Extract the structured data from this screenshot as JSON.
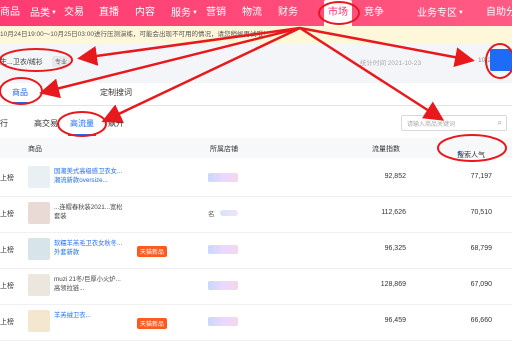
{
  "topnav": {
    "items": [
      {
        "label": "商品",
        "caret": false
      },
      {
        "label": "品类",
        "caret": true
      },
      {
        "label": "交易",
        "caret": false
      },
      {
        "label": "直播",
        "caret": false
      },
      {
        "label": "内容",
        "caret": false
      },
      {
        "label": "服务",
        "caret": true
      },
      {
        "label": "营销",
        "caret": false
      },
      {
        "label": "物流",
        "caret": false
      },
      {
        "label": "财务",
        "caret": false
      },
      {
        "label": "市场",
        "caret": false,
        "active": true
      },
      {
        "label": "竞争",
        "caret": false
      },
      {
        "label": "业务专区",
        "caret": true
      },
      {
        "label": "自助分",
        "caret": false
      }
    ]
  },
  "notice": {
    "text": "10月24日19:00～10月25日03:00进行压测演练，可能会出现不可用的情况，请您稍候再试哦！"
  },
  "filter": {
    "category": "生...卫衣/绒衫",
    "chip": "专业",
    "date": "统计时间 2021-10-23",
    "date_end": "10-23"
  },
  "tabs": [
    {
      "label": "商品",
      "active": true
    },
    {
      "label": "定制搜词",
      "active": false
    }
  ],
  "subtabs": [
    {
      "label": "行",
      "active": false
    },
    {
      "label": "高交易",
      "active": false
    },
    {
      "label": "高流量",
      "active": true
    },
    {
      "label": "飙升",
      "active": false
    }
  ],
  "search": {
    "placeholder": "请输入商品关键词"
  },
  "table": {
    "headers": {
      "rank": "",
      "product": "商品",
      "shop": "所属店铺",
      "flow": "流量指数",
      "pop": "搜索人气"
    },
    "rows": [
      {
        "rank": "上榜",
        "name": "国潮美式高级感卫衣女...潮流新款oversize...",
        "tag": "",
        "shop": "",
        "flow": "92,852",
        "pop": "77,197",
        "thumb": "#e8f0f4"
      },
      {
        "rank": "上榜",
        "name": "...连帽春秋装2021...宽松套装",
        "tag": "",
        "shop": "名",
        "flow": "112,626",
        "pop": "70,510",
        "thumb": "#e9dad6"
      },
      {
        "rank": "上榜",
        "name": "软糯羊羔毛卫衣女秋冬...外套新款",
        "tag": "天猫新品",
        "shop": "",
        "flow": "96,325",
        "pop": "68,799",
        "thumb": "#d7e4ea"
      },
      {
        "rank": "上榜",
        "name": "muzi 21冬/巨厚小火炉...高领拉链...",
        "tag": "",
        "shop": "",
        "flow": "128,869",
        "pop": "67,090",
        "thumb": "#ece7de"
      },
      {
        "rank": "上榜",
        "name": "羊羔绒卫衣...",
        "tag": "天猫新品",
        "shop": "",
        "flow": "96,459",
        "pop": "66,660",
        "thumb": "#f3e7cf"
      }
    ]
  },
  "colors": {
    "accent": "#ff2d6b",
    "link": "#1e6bf5",
    "annotation": "#e8191c",
    "tag": "#ff5a1f"
  }
}
